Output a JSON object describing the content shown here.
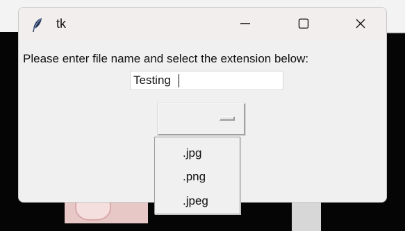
{
  "window": {
    "title": "tk",
    "icon": "feather-icon"
  },
  "titlebar_controls": {
    "minimize_icon": "minimize-icon",
    "maximize_icon": "maximize-icon",
    "close_icon": "close-icon"
  },
  "form": {
    "prompt_label": "Please enter file name and select the extension below:",
    "filename_value": "Testing",
    "extension_selected": ""
  },
  "dropdown": {
    "options": [
      ".jpg",
      ".png",
      ".jpeg"
    ]
  },
  "colors": {
    "window_bg": "#f0f0f0",
    "titlebar_bg": "#f3eeee",
    "background_dark": "#050505"
  }
}
